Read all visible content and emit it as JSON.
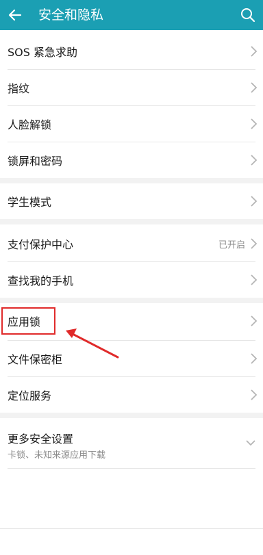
{
  "header": {
    "title": "安全和隐私",
    "back_icon": "arrow-left-icon",
    "search_icon": "search-icon",
    "background_color": "#1b9fb3"
  },
  "sections": [
    {
      "items": [
        {
          "label": "SOS 紧急求助"
        },
        {
          "label": "指纹"
        },
        {
          "label": "人脸解锁"
        },
        {
          "label": "锁屏和密码"
        }
      ]
    },
    {
      "items": [
        {
          "label": "学生模式"
        }
      ]
    },
    {
      "items": [
        {
          "label": "支付保护中心",
          "status": "已开启"
        },
        {
          "label": "查找我的手机"
        }
      ]
    },
    {
      "items": [
        {
          "label": "应用锁",
          "highlighted": true
        },
        {
          "label": "文件保密柜"
        },
        {
          "label": "定位服务"
        }
      ]
    }
  ],
  "more_settings": {
    "title": "更多安全设置",
    "subtitle": "卡锁、未知来源应用下载",
    "expand_icon": "chevron-down-icon"
  },
  "annotation": {
    "box_color": "#e02a2a",
    "arrow_color": "#e02a2a"
  }
}
